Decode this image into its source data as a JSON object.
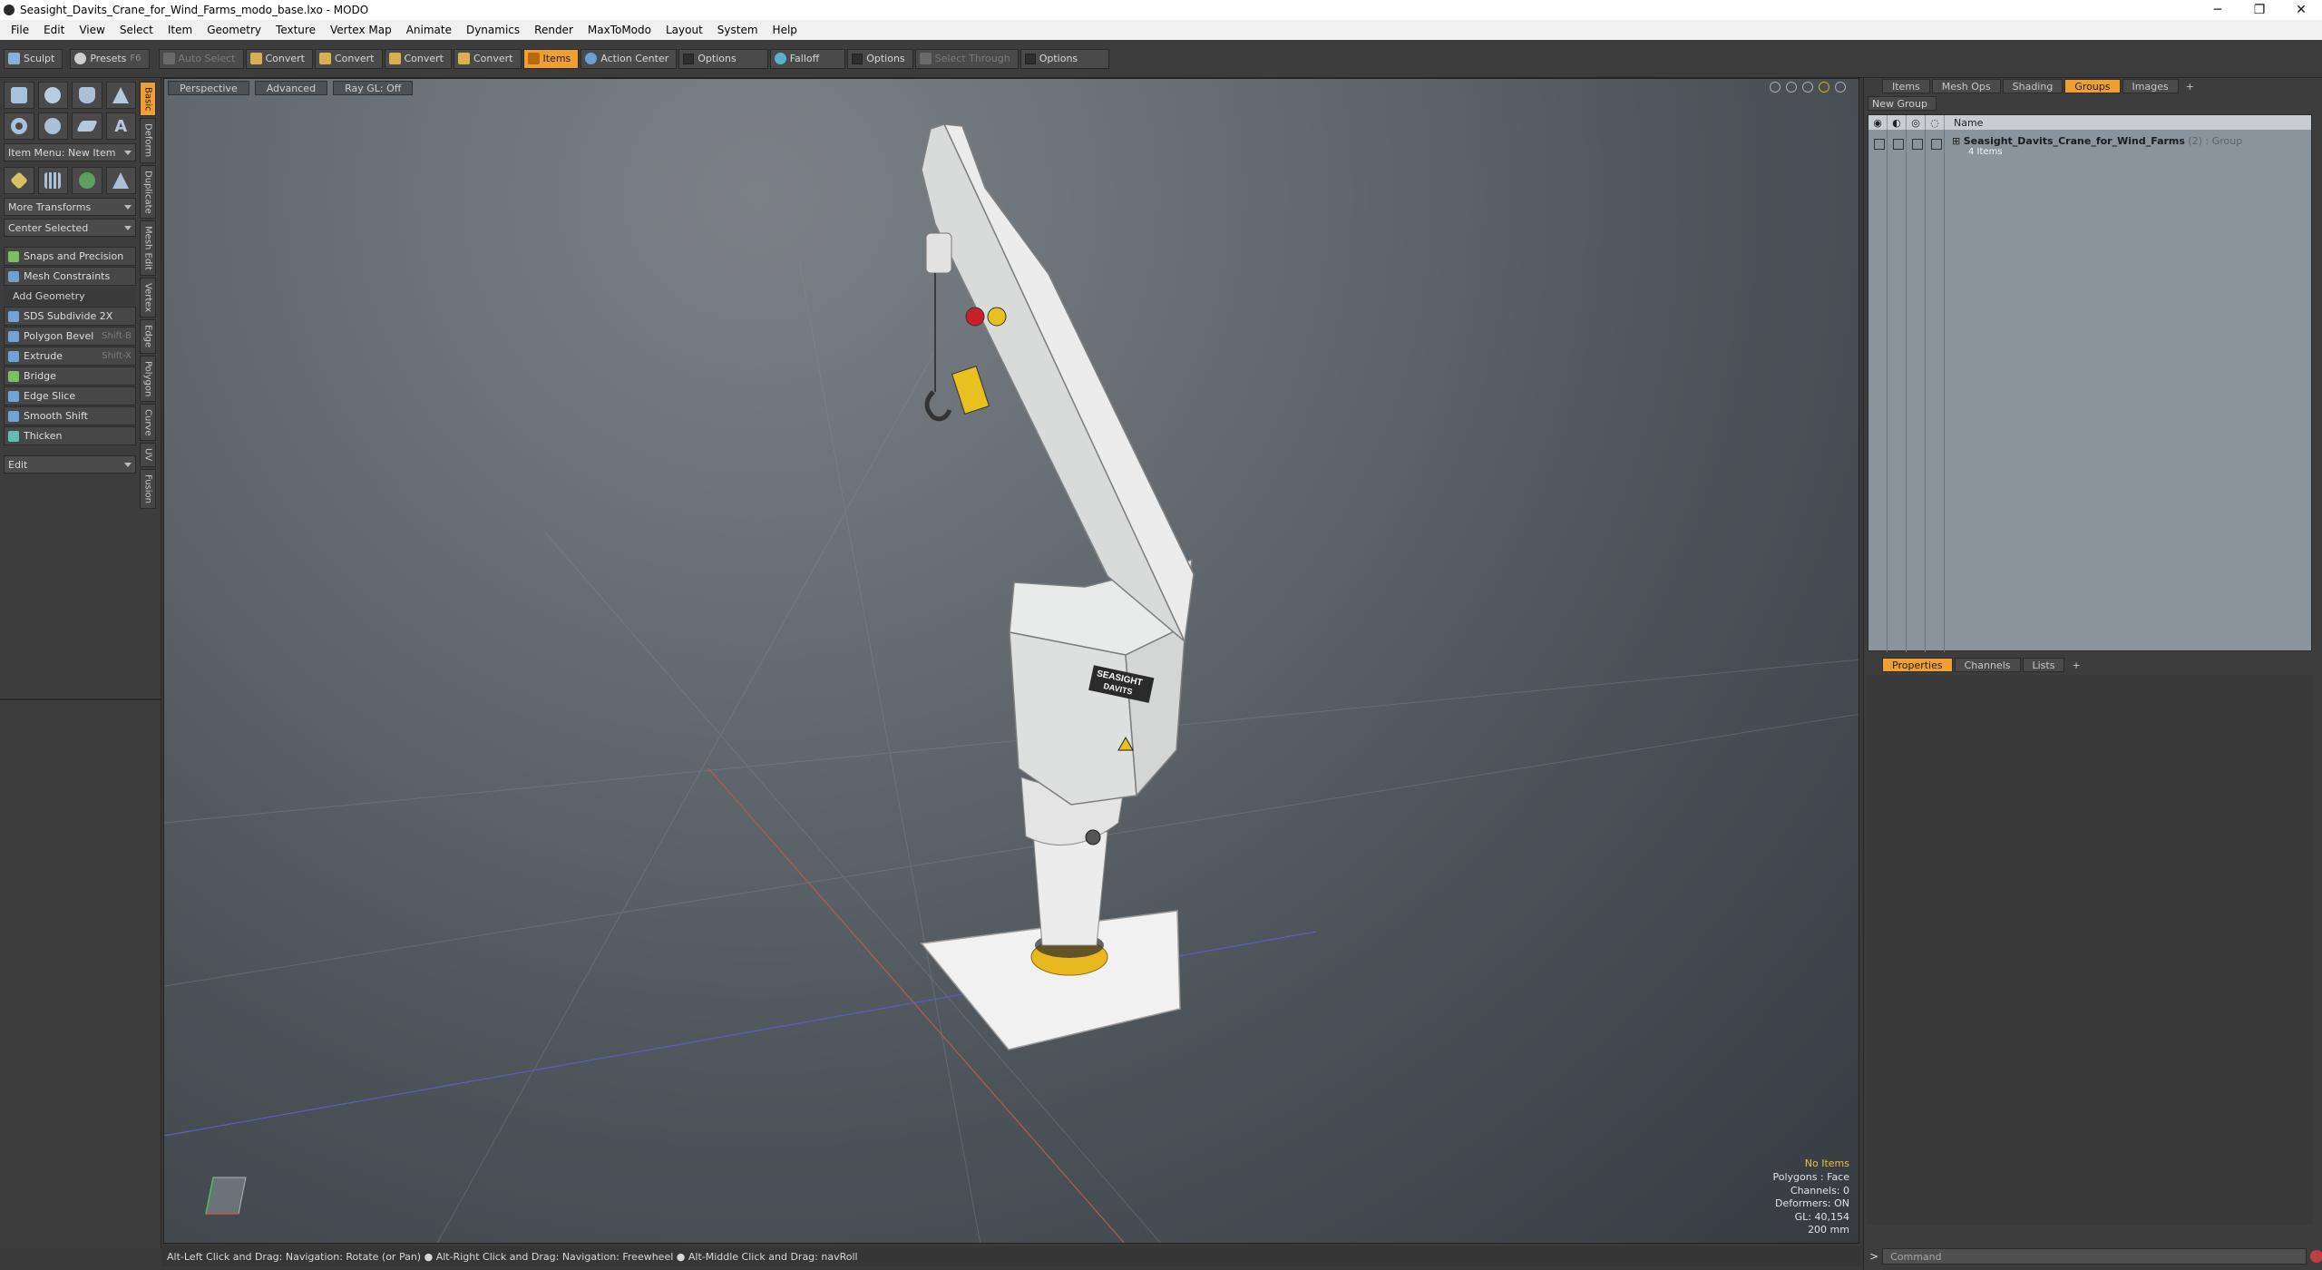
{
  "window": {
    "title": "Seasight_Davits_Crane_for_Wind_Farms_modo_base.lxo - MODO",
    "minimize": "─",
    "maximize": "❐",
    "close": "✕"
  },
  "menu": [
    "File",
    "Edit",
    "View",
    "Select",
    "Item",
    "Geometry",
    "Texture",
    "Vertex Map",
    "Animate",
    "Dynamics",
    "Render",
    "MaxToModo",
    "Layout",
    "System",
    "Help"
  ],
  "toolbar": {
    "sculpt": "Sculpt",
    "presets": "Presets",
    "presets_key": "F6",
    "auto_select": "Auto Select",
    "convert1": "Convert",
    "convert2": "Convert",
    "convert3": "Convert",
    "convert4": "Convert",
    "items": "Items",
    "action_center": "Action Center",
    "options1": "Options",
    "falloff": "Falloff",
    "options2": "Options",
    "select_through": "Select Through",
    "options3": "Options"
  },
  "left_panel": {
    "item_menu": "Item Menu: New Item",
    "more_transforms": "More Transforms",
    "center_selected": "Center Selected",
    "snaps": "Snaps and Precision",
    "mesh_constraints": "Mesh Constraints",
    "add_geometry": "Add Geometry",
    "tools": [
      {
        "label": "SDS Subdivide 2X",
        "shortcut": ""
      },
      {
        "label": "Polygon Bevel",
        "shortcut": "Shift-B"
      },
      {
        "label": "Extrude",
        "shortcut": "Shift-X"
      },
      {
        "label": "Bridge",
        "shortcut": ""
      },
      {
        "label": "Edge Slice",
        "shortcut": ""
      },
      {
        "label": "Smooth Shift",
        "shortcut": ""
      },
      {
        "label": "Thicken",
        "shortcut": ""
      }
    ],
    "edit_dropdown": "Edit",
    "vtabs": [
      "Basic",
      "Deform",
      "Duplicate",
      "Mesh Edit",
      "Vertex",
      "Edge",
      "Polygon",
      "Curve",
      "UV",
      "Fusion"
    ]
  },
  "viewport": {
    "perspective": "Perspective",
    "advanced": "Advanced",
    "raygl": "Ray GL: Off",
    "info": {
      "no_items": "No Items",
      "polygons": "Polygons : Face",
      "channels": "Channels: 0",
      "deformers": "Deformers: ON",
      "gl": "GL: 40,154",
      "scale": "200 mm"
    },
    "logo_line1": "SEASIGHT",
    "logo_line2": "DAVITS",
    "colors": {
      "crane_body": "#e9eaea",
      "accent_yellow": "#e8b820",
      "x_axis": "#b85a4a",
      "z_axis": "#5a5ec8"
    }
  },
  "status_bar": "Alt-Left Click and Drag: Navigation: Rotate (or Pan) ● Alt-Right Click and Drag: Navigation: Freewheel ● Alt-Middle Click and Drag: navRoll",
  "right_panel": {
    "tabs": [
      "Items",
      "Mesh Ops",
      "Shading",
      "Groups",
      "Images"
    ],
    "new_group": "New Group",
    "col_name": "Name",
    "group_name": "Seasight_Davits_Crane_for_Wind_Farms",
    "group_meta": "(2) : Group",
    "group_items": "4 Items",
    "prop_tabs": [
      "Properties",
      "Channels",
      "Lists"
    ],
    "command_placeholder": "Command"
  }
}
